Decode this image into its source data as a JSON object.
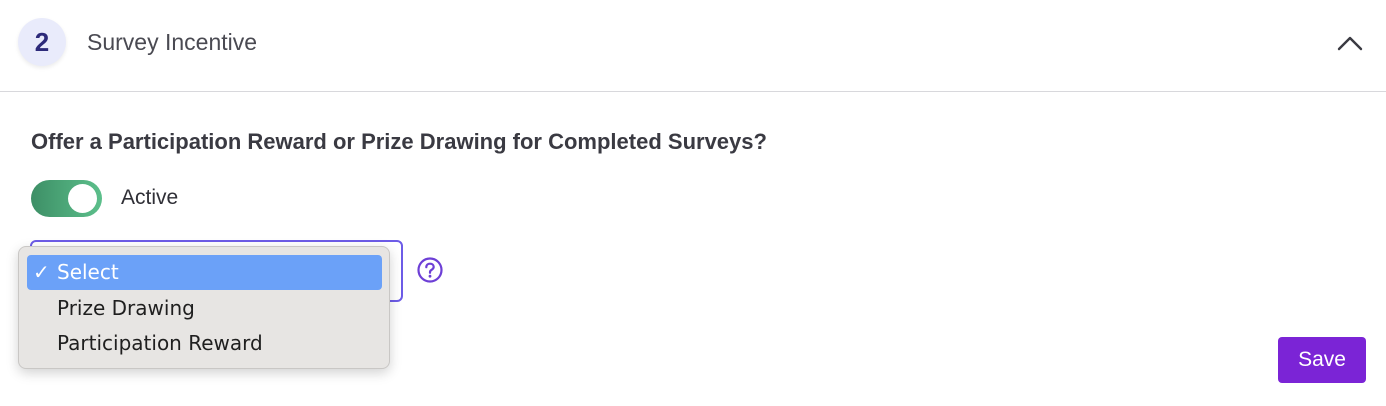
{
  "section": {
    "step_number": "2",
    "title": "Survey Incentive"
  },
  "question": "Offer a Participation Reward or Prize Drawing for Completed Surveys?",
  "toggle": {
    "label": "Active",
    "on": true
  },
  "select": {
    "selected_value": "Select",
    "options": [
      {
        "check": "✓",
        "label": "Select"
      },
      {
        "check": "",
        "label": "Prize Drawing"
      },
      {
        "check": "",
        "label": "Participation Reward"
      }
    ]
  },
  "save_label": "Save",
  "colors": {
    "accent": "#7b24d6",
    "select_border": "#6d5ce7",
    "toggle_on": "#4aa677",
    "highlight": "#6ba1f8"
  }
}
